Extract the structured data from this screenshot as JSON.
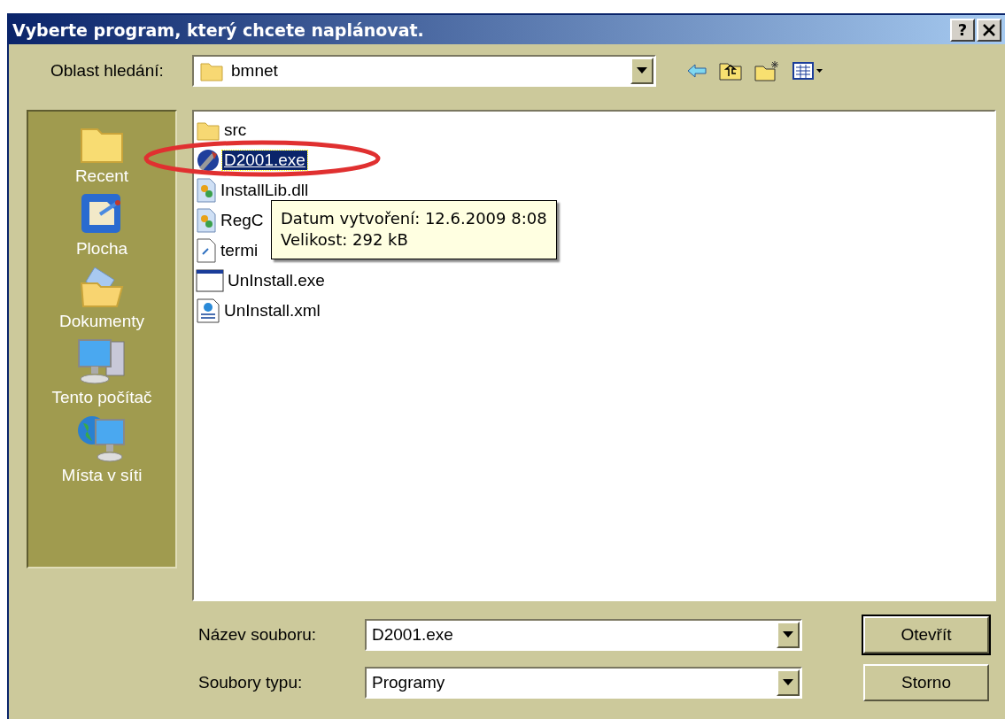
{
  "window": {
    "title": "Vyberte program, který chcete naplánovat."
  },
  "title_buttons": [
    {
      "kind": "help",
      "label": "?"
    },
    {
      "kind": "close"
    }
  ],
  "look_in": {
    "label": "Oblast hledání:",
    "value": "bmnet"
  },
  "toolbar": [
    {
      "kind": "back"
    },
    {
      "kind": "up"
    },
    {
      "kind": "new-folder"
    },
    {
      "kind": "views"
    }
  ],
  "places": [
    {
      "label": "Recent",
      "kind": "recent"
    },
    {
      "label": "Plocha",
      "kind": "desktop"
    },
    {
      "label": "Dokumenty",
      "kind": "documents"
    },
    {
      "label": "Tento počítač",
      "kind": "computer"
    },
    {
      "label": "Místa v síti",
      "kind": "network"
    }
  ],
  "files": [
    {
      "name": "src",
      "kind": "folder",
      "selected": false
    },
    {
      "name": "D2001.exe",
      "kind": "app",
      "selected": true
    },
    {
      "name": "InstallLib.dll",
      "kind": "dll",
      "selected": false
    },
    {
      "name": "RegC",
      "kind": "dll",
      "selected": false
    },
    {
      "name": "termi",
      "kind": "doc",
      "selected": false
    },
    {
      "name": "UnInstall.exe",
      "kind": "window",
      "selected": false
    },
    {
      "name": "UnInstall.xml",
      "kind": "xml",
      "selected": false
    }
  ],
  "tooltip": {
    "lines": [
      "Datum vytvoření: 12.6.2009 8:08",
      "Velikost: 292 kB"
    ]
  },
  "file_name": {
    "label": "Název souboru:",
    "value": "D2001.exe"
  },
  "file_type": {
    "label": "Soubory typu:",
    "value": "Programy"
  },
  "buttons": [
    {
      "label": "Otevřít",
      "default": true
    },
    {
      "label": "Storno",
      "default": false
    }
  ]
}
